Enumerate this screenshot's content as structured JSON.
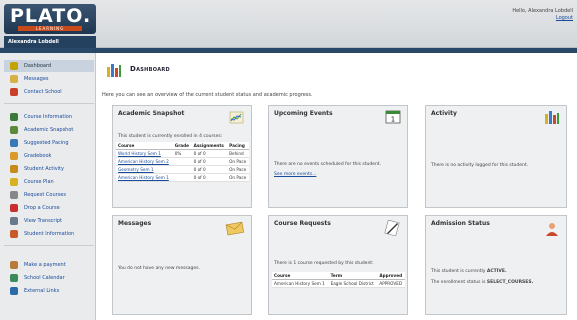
{
  "header": {
    "logo_text": "PLATO.",
    "logo_sub": "LEARNING",
    "username": "Alexandra Lobdell",
    "greeting": "Hello, Alexandra Lobdell",
    "logout": "Logout"
  },
  "sidebar": {
    "items": [
      {
        "label": "Dashboard",
        "icon": "dashboard-icon",
        "color": "#c4a200"
      },
      {
        "label": "Messages",
        "icon": "envelope-icon",
        "color": "#d8b048"
      },
      {
        "label": "Contact School",
        "icon": "lifebuoy-icon",
        "color": "#c8402a"
      },
      {
        "label": "Course Information",
        "icon": "books-icon",
        "color": "#3a7a3a"
      },
      {
        "label": "Academic Snapshot",
        "icon": "chart-icon",
        "color": "#5a8a3a"
      },
      {
        "label": "Suggested Pacing",
        "icon": "pacing-icon",
        "color": "#3a78b8"
      },
      {
        "label": "Gradebook",
        "icon": "gradebook-icon",
        "color": "#d89a2a"
      },
      {
        "label": "Student Activity",
        "icon": "activity-icon",
        "color": "#c88a1a"
      },
      {
        "label": "Course Plan",
        "icon": "plan-icon",
        "color": "#d8b020"
      },
      {
        "label": "Request Courses",
        "icon": "request-icon",
        "color": "#888888"
      },
      {
        "label": "Drop a Course",
        "icon": "drop-icon",
        "color": "#c83030"
      },
      {
        "label": "View Transcript",
        "icon": "transcript-icon",
        "color": "#6a7a8a"
      },
      {
        "label": "Student Information",
        "icon": "student-icon",
        "color": "#c85a2a"
      },
      {
        "label": "Make a payment",
        "icon": "payment-icon",
        "color": "#b87a3a"
      },
      {
        "label": "School Calendar",
        "icon": "calendar-icon",
        "color": "#3a8a5a"
      },
      {
        "label": "External Links",
        "icon": "globe-icon",
        "color": "#2a6aa8"
      }
    ]
  },
  "main": {
    "title": "Dashboard",
    "overview": "Here you can see an overview of the current student status and academic progress."
  },
  "academic_snapshot": {
    "title": "Academic Snapshot",
    "enrolled_text": "This student is currently enrolled in 4 courses:",
    "headers": [
      "Course",
      "Grade",
      "Assignments",
      "Pacing"
    ],
    "rows": [
      {
        "course": "World History Sem 1",
        "grade": "0%",
        "assignments": "0 of 0",
        "pacing": "Behind"
      },
      {
        "course": "American History Sem 2",
        "grade": "",
        "assignments": "0 of 0",
        "pacing": "On Pace"
      },
      {
        "course": "Geometry Sem 1",
        "grade": "",
        "assignments": "0 of 0",
        "pacing": "On Pace"
      },
      {
        "course": "American History Sem 1",
        "grade": "",
        "assignments": "0 of 0",
        "pacing": "On Pace"
      }
    ]
  },
  "upcoming_events": {
    "title": "Upcoming Events",
    "empty_text": "There are no events scheduled for this student.",
    "see_more": "See more events..."
  },
  "activity": {
    "title": "Activity",
    "empty_text": "There is no activity logged for this student."
  },
  "messages": {
    "title": "Messages",
    "empty_text": "You do not have any new messages."
  },
  "course_requests": {
    "title": "Course Requests",
    "summary": "There is 1 course requested by this student:",
    "headers": [
      "Course",
      "Term",
      "Approved"
    ],
    "rows": [
      {
        "course": "American History Sem 1",
        "term": "Eagle School District",
        "approved": "APPROVED"
      }
    ]
  },
  "admission_status": {
    "title": "Admission Status",
    "status_prefix": "This student is currently",
    "status_value": "ACTIVE.",
    "enrollment_prefix": "The enrollment status is",
    "enrollment_value": "SELECT_COURSES."
  }
}
